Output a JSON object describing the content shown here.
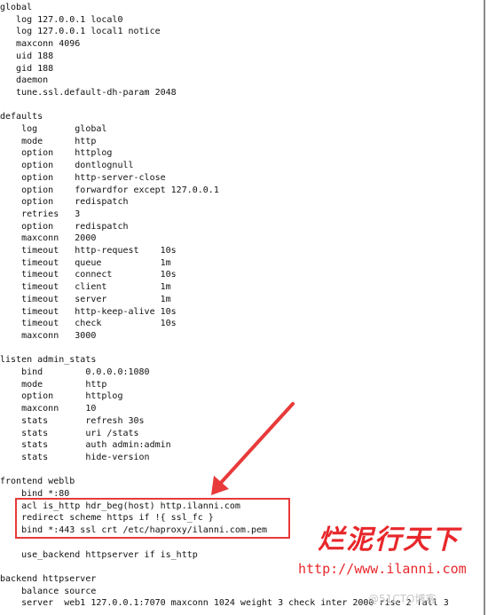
{
  "terminal": {
    "lines": [
      "global",
      "   log 127.0.0.1 local0",
      "   log 127.0.0.1 local1 notice",
      "   maxconn 4096",
      "   uid 188",
      "   gid 188",
      "   daemon",
      "   tune.ssl.default-dh-param 2048",
      "",
      "defaults",
      "    log       global",
      "    mode      http",
      "    option    httplog",
      "    option    dontlognull",
      "    option    http-server-close",
      "    option    forwardfor except 127.0.0.1",
      "    option    redispatch",
      "    retries   3",
      "    option    redispatch",
      "    maxconn   2000",
      "    timeout   http-request    10s",
      "    timeout   queue           1m",
      "    timeout   connect         10s",
      "    timeout   client          1m",
      "    timeout   server          1m",
      "    timeout   http-keep-alive 10s",
      "    timeout   check           10s",
      "    maxconn   3000",
      "",
      "listen admin_stats",
      "    bind        0.0.0.0:1080",
      "    mode        http",
      "    option      httplog",
      "    maxconn     10",
      "    stats       refresh 30s",
      "    stats       uri /stats",
      "    stats       auth admin:admin",
      "    stats       hide-version",
      "",
      "frontend weblb",
      "    bind *:80",
      "    acl is_http hdr_beg(host) http.ilanni.com",
      "    redirect scheme https if !{ ssl_fc }",
      "    bind *:443 ssl crt /etc/haproxy/ilanni.com.pem",
      "",
      "    use_backend httpserver if is_http",
      "",
      "backend httpserver",
      "    balance source",
      "    server  web1 127.0.0.1:7070 maxconn 1024 weight 3 check inter 2000 rise 2 fall 3"
    ]
  },
  "annotation": {
    "highlight_color": "#e83a3a",
    "arrow": "arrow-pointing-to-highlight"
  },
  "watermark": {
    "title": "烂泥行天下",
    "url": "http://www.ilanni.com",
    "source": "@51CTO博客"
  }
}
